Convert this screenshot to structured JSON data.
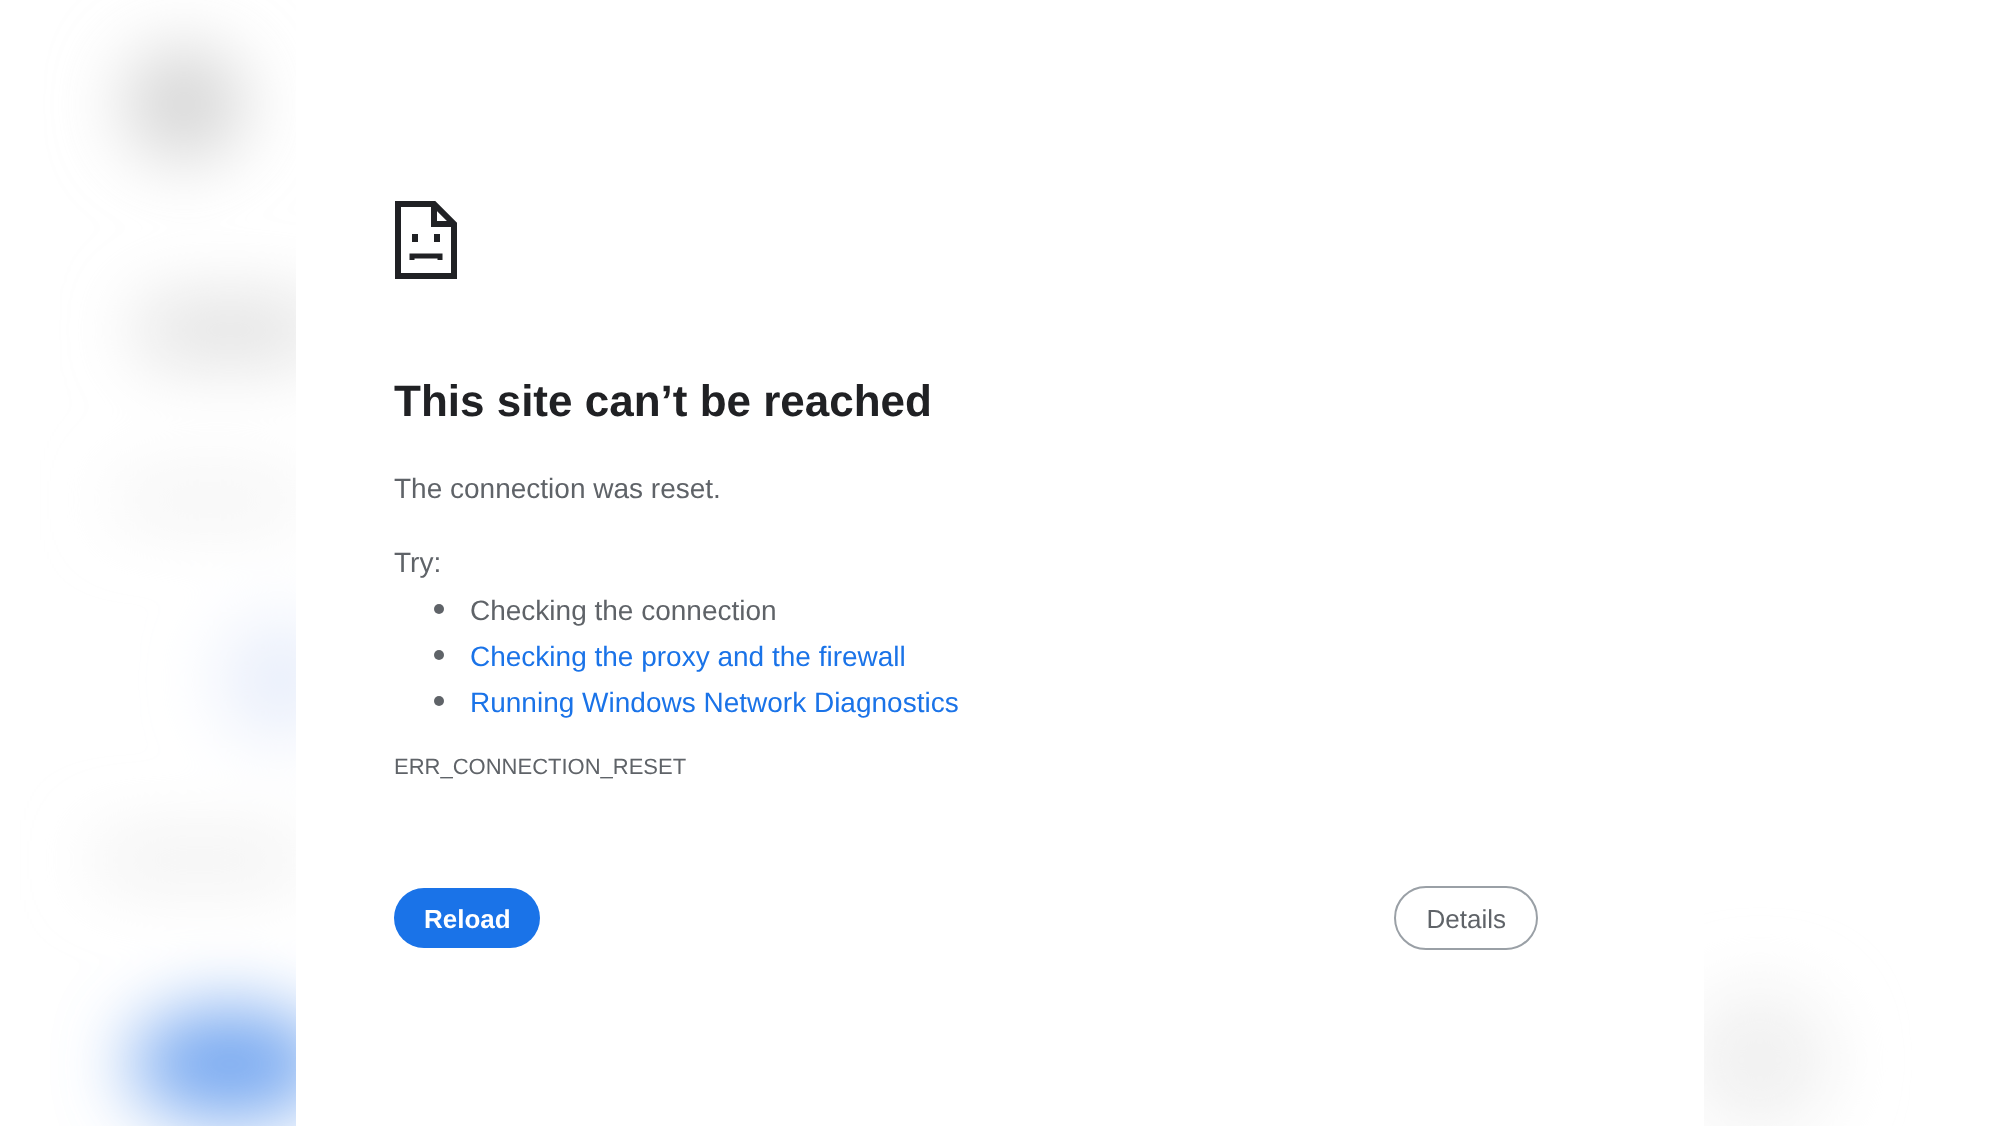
{
  "title": "This site can’t be reached",
  "message": "The connection was reset.",
  "try_label": "Try:",
  "suggestions": [
    {
      "text": "Checking the connection",
      "kind": "text"
    },
    {
      "text": "Checking the proxy and the firewall",
      "kind": "link"
    },
    {
      "text": "Running Windows Network Diagnostics",
      "kind": "link"
    }
  ],
  "error_code": "ERR_CONNECTION_RESET",
  "buttons": [
    {
      "label": "Reload",
      "kind": "primary"
    },
    {
      "label": "Details",
      "kind": "secondary"
    }
  ]
}
